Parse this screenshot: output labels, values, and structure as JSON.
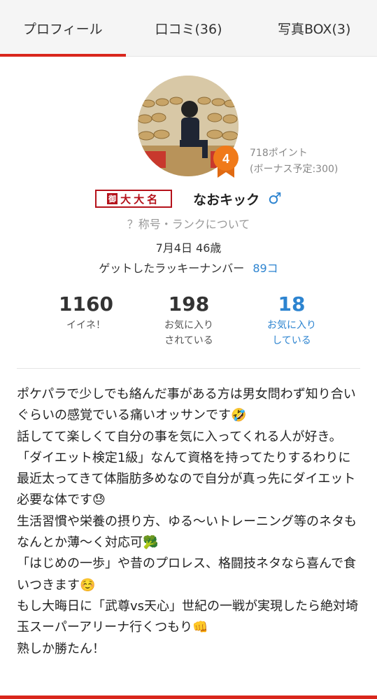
{
  "tabs": [
    {
      "label": "プロフィール",
      "active": true
    },
    {
      "label": "口コミ(36)",
      "active": false
    },
    {
      "label": "写真BOX(3)",
      "active": false
    }
  ],
  "profile": {
    "level": "4",
    "points": "718ポイント",
    "bonus": "(ボーナス予定:300)",
    "title_badge": "大大名",
    "title_mark": "御",
    "username": "なおキック",
    "gender_icon": "♂",
    "rank_link": "？称号・ランクについて",
    "birth": "7月4日 46歳",
    "lucky_label": "ゲットしたラッキーナンバー",
    "lucky_count": "89コ"
  },
  "stats": [
    {
      "num": "1160",
      "label": "イイネ！"
    },
    {
      "num": "198",
      "label": "お気に入り\nされている"
    },
    {
      "num": "18",
      "label": "お気に入り\nしている"
    }
  ],
  "bio": "ポケパラで少しでも絡んだ事がある方は男女問わず知り合いぐらいの感覚でいる痛いオッサンです🤣\n話してて楽しくて自分の事を気に入ってくれる人が好き。\n「ダイエット検定1級」なんて資格を持ってたりするわりに最近太ってきて体脂肪多めなので自分が真っ先にダイエット必要な体です😓\n生活習慣や栄養の摂り方、ゆる〜いトレーニング等のネタもなんとか薄〜く対応可🥦\n「はじめの一歩」や昔のプロレス、格闘技ネタなら喜んで食いつきます☺️\nもし大晦日に「武尊vs天心」世紀の一戦が実現したら絶対埼玉スーパーアリーナ行くつもり👊\n熟しか勝たん！",
  "colors": {
    "accent": "#d9261c",
    "link": "#2d84d0",
    "badge": "#f07a1a"
  }
}
